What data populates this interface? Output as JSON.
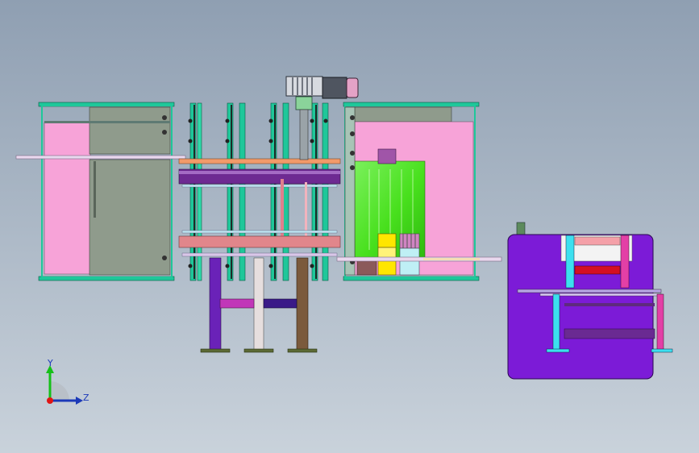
{
  "scene": {
    "background_top": "#8f9fb2",
    "background_bottom": "#c9d2db"
  },
  "colors": {
    "frame_green": "#1fc79a",
    "panel_gray": "#8f9b8c",
    "panel_pink": "#f7a3d8",
    "purple_block": "#7c1bd7",
    "lime": "#48e01d",
    "motor_gray": "#4f5560",
    "beam_salmon": "#e1868b",
    "beam_violet": "#6e2a92",
    "leg_brown": "#7b5a3c",
    "leg_gray": "#cfcfcf",
    "yellow": "#ffe600",
    "cyan": "#3ce0ef",
    "red": "#d40f22"
  },
  "triad": {
    "y_label": "Y",
    "z_label": "Z"
  }
}
